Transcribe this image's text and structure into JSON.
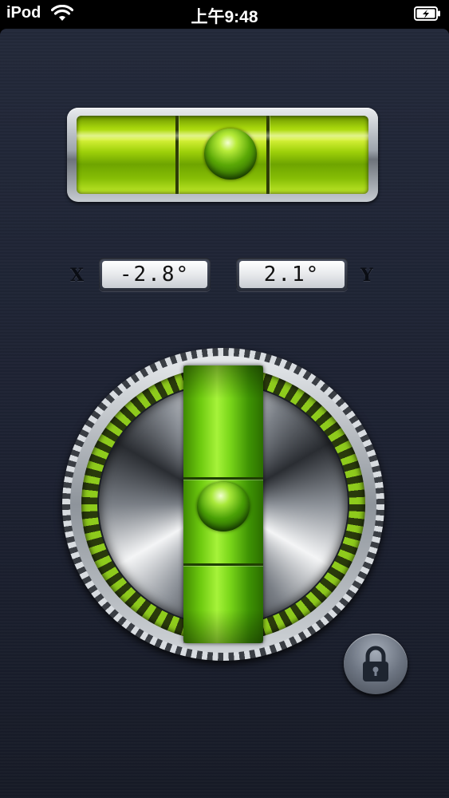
{
  "status_bar": {
    "carrier": "iPod",
    "time": "上午9:48",
    "wifi_icon": "wifi-icon",
    "battery_icon": "battery-charging-icon"
  },
  "level": {
    "x_axis_label": "X",
    "y_axis_label": "Y",
    "x_value": "-2.8°",
    "y_value": "2.1°",
    "lock_icon": "lock-icon",
    "accent_color": "#8fd414"
  }
}
